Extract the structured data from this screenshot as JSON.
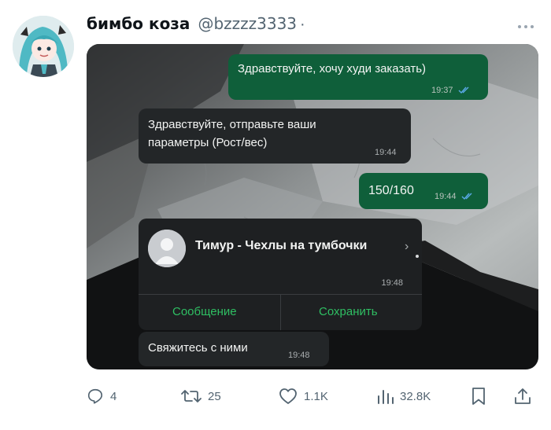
{
  "post": {
    "display_name": "бимбо коза",
    "handle": "@bzzzz3333",
    "separator": "·"
  },
  "chat": {
    "messages": [
      {
        "direction": "out",
        "text": "Здравствуйте, хочу худи заказать)",
        "time": "19:37",
        "read": true
      },
      {
        "direction": "in",
        "text_line1": "Здравствуйте, отправьте ваши",
        "text_line2": "параметры (Рост/вес)",
        "time": "19:44"
      },
      {
        "direction": "out",
        "text": "150/160",
        "time": "19:44",
        "read": true
      }
    ],
    "contact_card": {
      "name": "Тимур - Чехлы на тумбочки",
      "chevron": "›",
      "time": "19:48",
      "message_button": "Сообщение",
      "save_button": "Сохранить"
    },
    "last_message": {
      "direction": "in",
      "text": "Свяжитесь с ними",
      "time": "19:48"
    }
  },
  "actions": {
    "replies": "4",
    "reposts": "25",
    "likes": "1.1K",
    "views": "32.8K"
  },
  "colors": {
    "outgoing_bubble": "#0f5f3a",
    "incoming_bubble": "#232628",
    "accent_green": "#2fbf63",
    "read_ticks": "#5aa9e6",
    "muted_text": "#536471"
  },
  "icons": [
    "reply-icon",
    "repost-icon",
    "like-icon",
    "views-icon",
    "bookmark-icon",
    "share-icon",
    "more-icon"
  ]
}
